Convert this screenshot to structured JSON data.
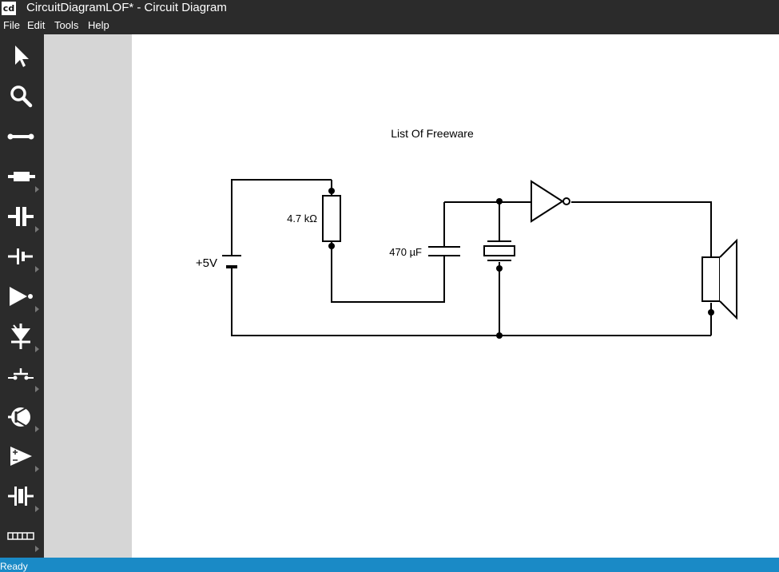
{
  "window": {
    "icon_text": "cd",
    "title": "CircuitDiagramLOF* - Circuit Diagram"
  },
  "menu": {
    "items": [
      "File",
      "Edit",
      "Tools",
      "Help"
    ]
  },
  "toolbox": {
    "tools": [
      {
        "icon": "pointer-icon"
      },
      {
        "icon": "magnifier-icon"
      },
      {
        "icon": "wire-icon"
      },
      {
        "icon": "resistor-icon"
      },
      {
        "icon": "capacitor-icon"
      },
      {
        "icon": "battery-icon"
      },
      {
        "icon": "logic-not-gate-icon"
      },
      {
        "icon": "diode-icon"
      },
      {
        "icon": "push-switch-icon"
      },
      {
        "icon": "transistor-icon"
      },
      {
        "icon": "op-amp-icon"
      },
      {
        "icon": "crystal-icon"
      },
      {
        "icon": "segmented-display-icon"
      }
    ]
  },
  "circuit": {
    "title": "List Of Freeware",
    "labels": {
      "supply": "+5V",
      "resistor": "4.7 kΩ",
      "capacitor": "470 µF"
    }
  },
  "status": {
    "text": "Ready"
  },
  "colors": {
    "chrome": "#2b2b2b",
    "margin": "#d6d6d6",
    "statusbar": "#1a8ac6",
    "canvas": "#ffffff"
  }
}
